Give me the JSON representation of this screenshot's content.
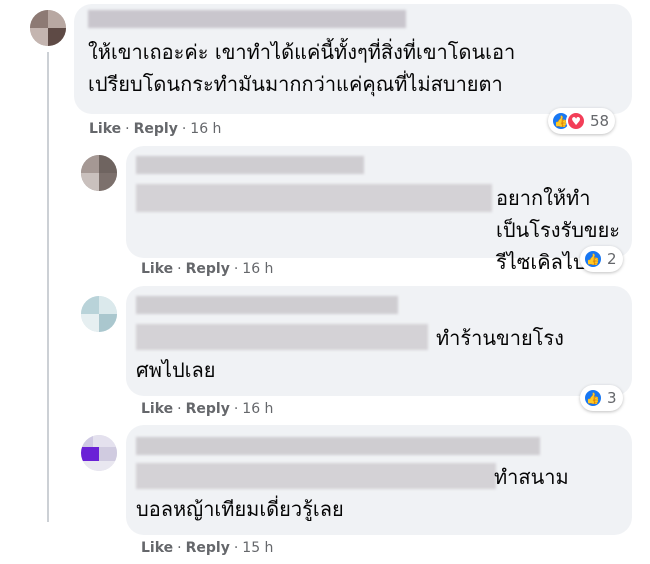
{
  "comments": [
    {
      "text": "ให้เขาเถอะค่ะ เขาทำได้แค่นี้ทั้งๆที่สิ่งที่เขาโดนเอา\nเปรียบโดนกระทำมันมากกว่าแค่คุณที่ไม่สบายตา",
      "like_label": "Like",
      "reply_label": "Reply",
      "time": "16 h",
      "reaction_count": "58",
      "reactions": [
        "like-icon",
        "love-icon"
      ]
    },
    {
      "text": "อยากให้ทำ\nเป็นโรงรับขยะรีไซเคิลไปเลย",
      "like_label": "Like",
      "reply_label": "Reply",
      "time": "16 h",
      "reaction_count": "2",
      "reactions": [
        "like-icon"
      ]
    },
    {
      "text": "ทำร้านขายโรง\nศพไปเลย",
      "like_label": "Like",
      "reply_label": "Reply",
      "time": "16 h",
      "reaction_count": "3",
      "reactions": [
        "like-icon"
      ]
    },
    {
      "text": "ทำสนาม\nบอลหญ้าเทียมเดี่ยวรู้เลย",
      "like_label": "Like",
      "reply_label": "Reply",
      "time": "15 h",
      "reactions": []
    }
  ],
  "colors": {
    "bubble": "#f0f2f5",
    "meta_text": "#65676b",
    "like_blue": "#1877f2",
    "love_red": "#f33e58"
  }
}
